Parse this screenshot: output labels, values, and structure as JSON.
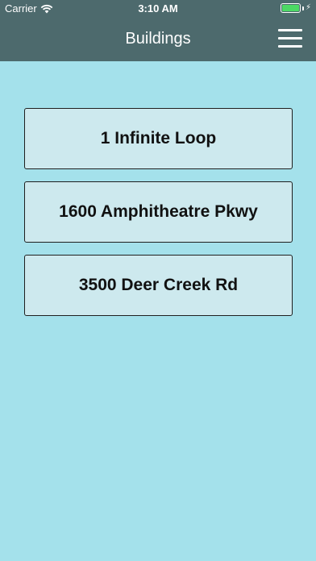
{
  "status_bar": {
    "carrier": "Carrier",
    "time": "3:10 AM",
    "battery_color": "#4cd964",
    "wifi_icon": "wifi-icon",
    "charging_icon": "bolt-icon"
  },
  "nav": {
    "title": "Buildings",
    "menu_icon": "hamburger-menu-icon",
    "background": "#4d6a6d"
  },
  "buildings": [
    {
      "label": "1 Infinite Loop"
    },
    {
      "label": "1600 Amphitheatre Pkwy"
    },
    {
      "label": "3500 Deer Creek Rd"
    }
  ],
  "colors": {
    "page_background": "#a4e1eb",
    "button_background": "#cde9ee"
  }
}
